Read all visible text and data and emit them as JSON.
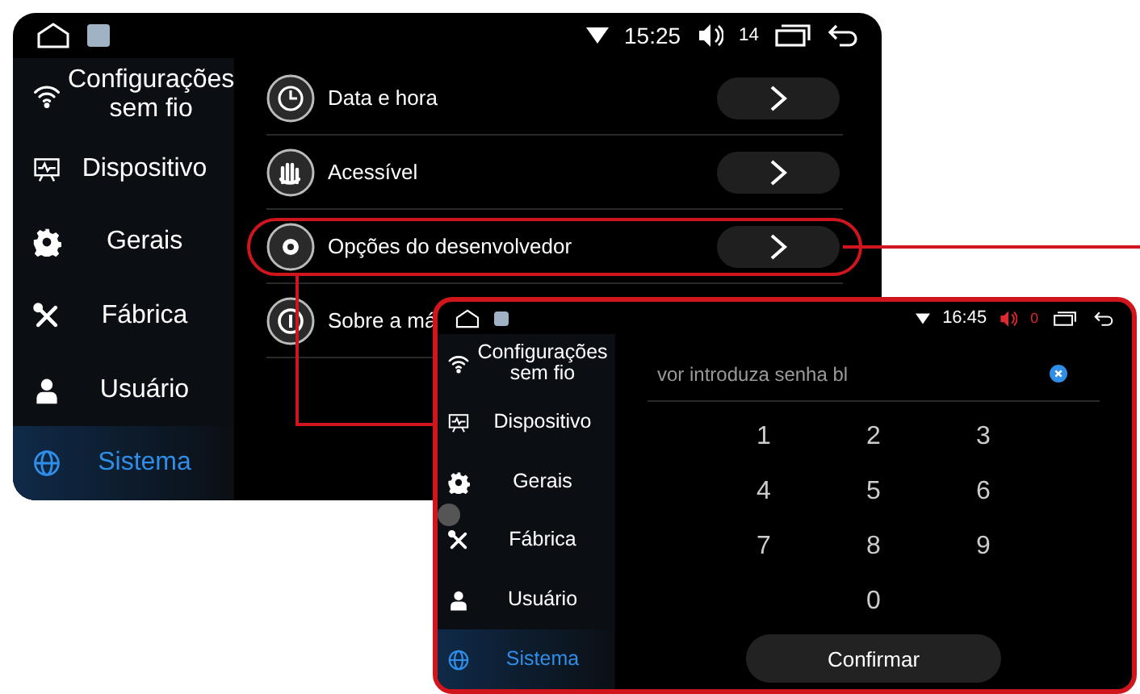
{
  "main_screen": {
    "status_bar": {
      "time": "15:25",
      "volume": "14",
      "muted": false
    },
    "sidebar": [
      {
        "label": "Configurações sem fio",
        "selected": false
      },
      {
        "label": "Dispositivo",
        "selected": false
      },
      {
        "label": "Gerais",
        "selected": false
      },
      {
        "label": "Fábrica",
        "selected": false
      },
      {
        "label": "Usuário",
        "selected": false
      },
      {
        "label": "Sistema",
        "selected": true
      }
    ],
    "settings": [
      {
        "label": "Data e hora",
        "highlighted": false,
        "arrow": true
      },
      {
        "label": "Acessível",
        "highlighted": false,
        "arrow": true
      },
      {
        "label": "Opções do desenvolvedor",
        "highlighted": true,
        "arrow": true
      },
      {
        "label": "Sobre a má",
        "highlighted": false,
        "arrow": false
      }
    ]
  },
  "password_screen": {
    "status_bar": {
      "time": "16:45",
      "volume": "0",
      "muted": true
    },
    "sidebar": [
      {
        "label": "Configurações sem fio",
        "selected": false
      },
      {
        "label": "Dispositivo",
        "selected": false
      },
      {
        "label": "Gerais",
        "selected": false
      },
      {
        "label": "Fábrica",
        "selected": false
      },
      {
        "label": "Usuário",
        "selected": false
      },
      {
        "label": "Sistema",
        "selected": true
      }
    ],
    "password_field": {
      "placeholder": "vor introduza senha bl"
    },
    "keypad": [
      "1",
      "2",
      "3",
      "4",
      "5",
      "6",
      "7",
      "8",
      "9",
      "0"
    ],
    "confirm_button": "Confirmar"
  }
}
